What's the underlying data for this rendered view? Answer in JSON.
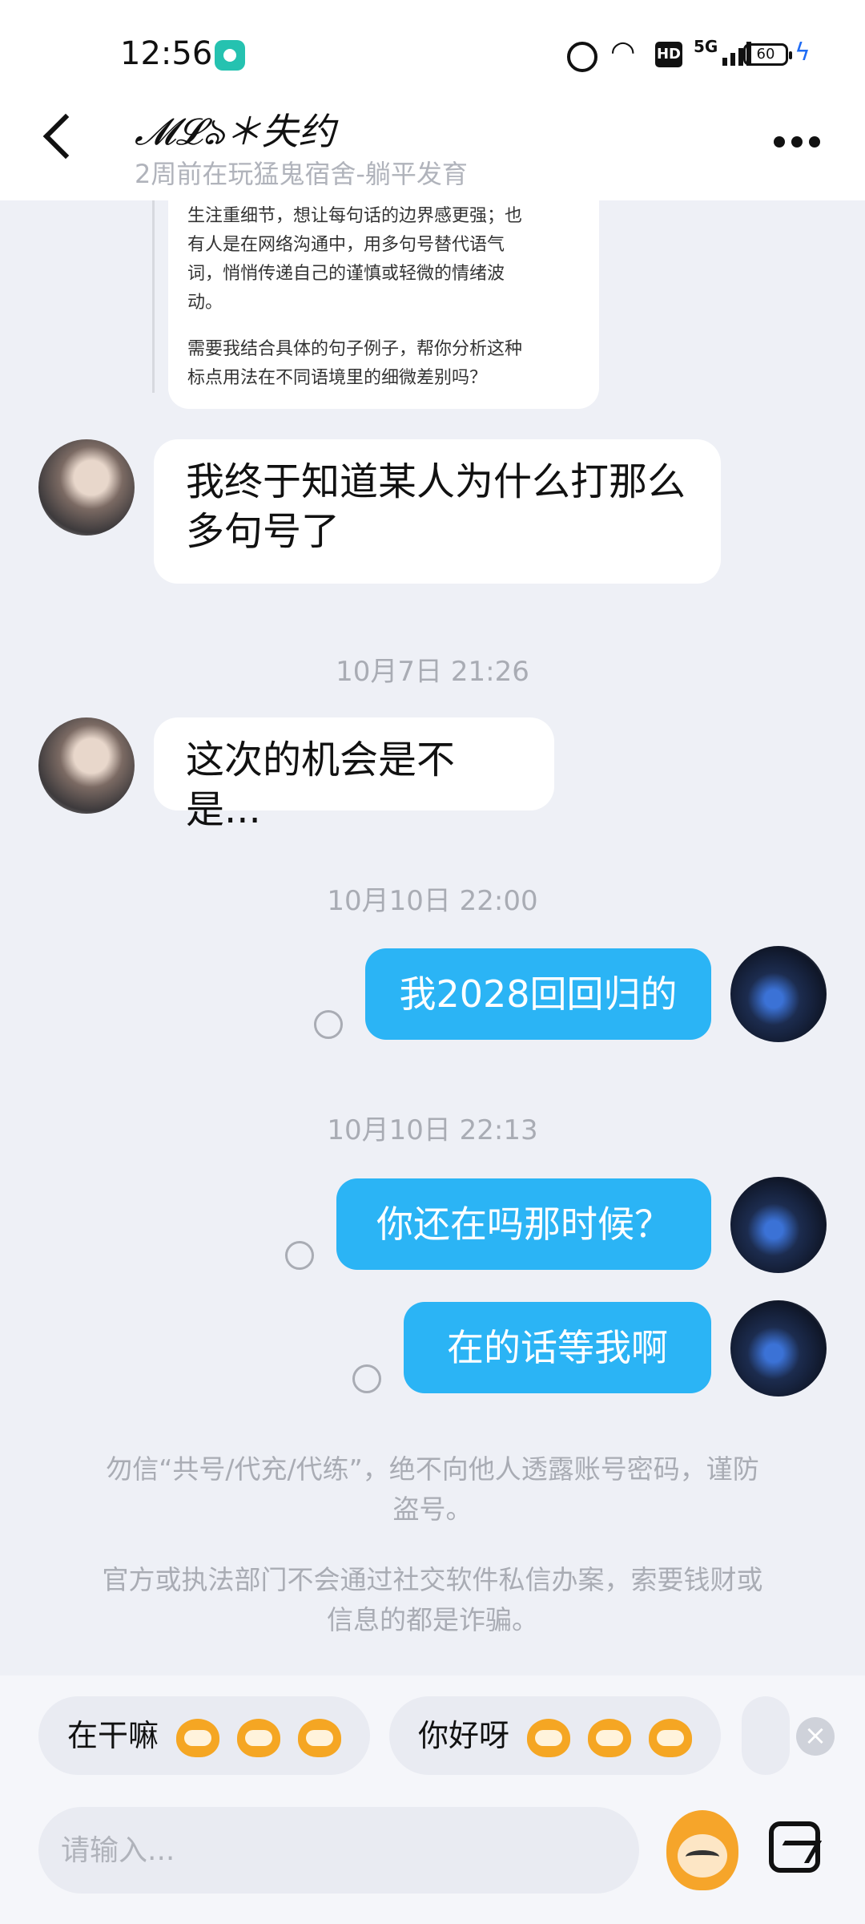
{
  "status_bar": {
    "time": "12:56",
    "hd": "HD",
    "network": "5G",
    "battery": "60"
  },
  "header": {
    "contact_name": "𝓜𝓛ঌ＊失约",
    "contact_status": "2周前在玩猛鬼宿舍-躺平发育"
  },
  "previous_message": {
    "lines": [
      "生注重细节，想让每句话的边界感更强；也",
      "有人是在网络沟通中，用多句号替代语气",
      "词，悄悄传递自己的谨慎或轻微的情绪波",
      "动。",
      "需要我结合具体的句子例子，帮你分析这种",
      "标点用法在不同语境里的细微差别吗？"
    ]
  },
  "messages": [
    {
      "side": "incoming",
      "text_line1": "我终于知道某人为什么打那么",
      "text_line2": "多句号了"
    },
    {
      "timestamp": "10月7日 21:26"
    },
    {
      "side": "incoming",
      "text": "这次的机会是不是..."
    },
    {
      "timestamp": "10月10日 22:00"
    },
    {
      "side": "outgoing",
      "text": "我2028回回归的"
    },
    {
      "timestamp": "10月10日 22:13"
    },
    {
      "side": "outgoing",
      "text": "你还在吗那时候？"
    },
    {
      "side": "outgoing",
      "text": "在的话等我啊"
    }
  ],
  "notices": {
    "security_line1": "勿信“共号/代充/代练”，绝不向他人透露账号密码，谨防",
    "security_line2": "盗号。",
    "fraud_line1": "官方或执法部门不会通过社交软件私信办案，索要钱财或",
    "fraud_line2": "信息的都是诈骗。"
  },
  "quick_replies": [
    {
      "label": "在干嘛",
      "emoji": "laughing-monkey"
    },
    {
      "label": "你好呀",
      "emoji": "wide-eyed-monkey"
    }
  ],
  "input": {
    "placeholder": "请输入..."
  }
}
